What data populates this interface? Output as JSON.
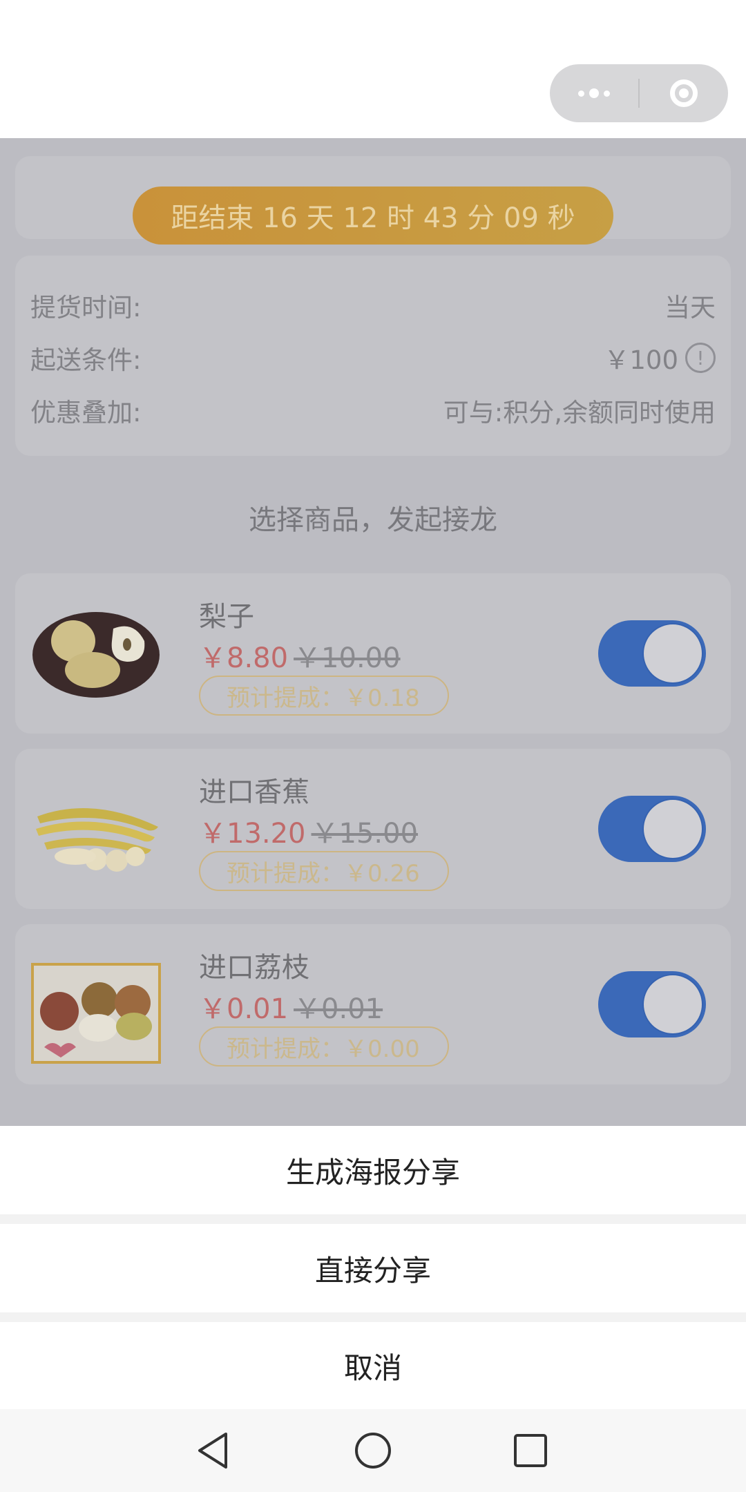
{
  "header": {
    "more_icon": "more-dots-icon",
    "close_icon": "target-circle-icon"
  },
  "countdown": {
    "text": "距结束 16 天 12 时 43 分 09 秒"
  },
  "info": {
    "rows": [
      {
        "label": "提货时间:",
        "value": "当天"
      },
      {
        "label": "起送条件:",
        "value": "￥100"
      },
      {
        "label": "优惠叠加:",
        "value": "可与:积分,余额同时使用"
      }
    ],
    "alert_icon": "exclamation-circle-icon"
  },
  "section_title": "选择商品，发起接龙",
  "products": [
    {
      "name": "梨子",
      "price": "￥8.80",
      "original_price": "￥10.00",
      "commission": "预计提成：￥0.18",
      "selected": true
    },
    {
      "name": "进口香蕉",
      "price": "￥13.20",
      "original_price": "￥15.00",
      "commission": "预计提成：￥0.26",
      "selected": true
    },
    {
      "name": "进口荔枝",
      "price": "￥0.01",
      "original_price": "￥0.01",
      "commission": "预计提成：￥0.00",
      "selected": true
    }
  ],
  "action_sheet": {
    "poster_share": "生成海报分享",
    "direct_share": "直接分享",
    "cancel": "取消"
  },
  "colors": {
    "toggle_on": "#3b69b8",
    "price": "#c06a6a",
    "countdown": "#c9923a"
  }
}
